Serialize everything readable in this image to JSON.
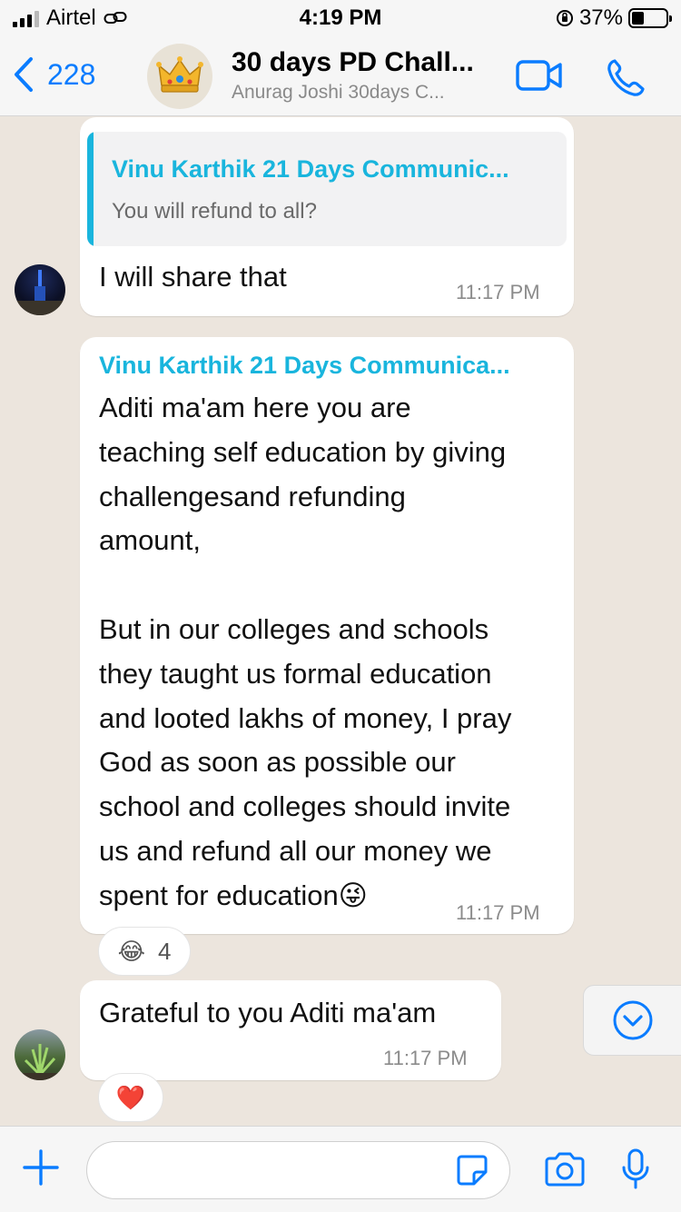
{
  "status_bar": {
    "carrier": "Airtel",
    "time": "4:19 PM",
    "battery": "37%",
    "battery_level": 0.37
  },
  "header": {
    "back_count": "228",
    "title": "30 days PD Chall...",
    "subtitle": "Anurag Joshi 30days C...",
    "avatar_icon": "crown-icon"
  },
  "messages": [
    {
      "quote_author": "Vinu Karthik 21 Days Communic...",
      "quote_text": "You will refund to all?",
      "text": "I will share that",
      "time": "11:17 PM"
    },
    {
      "sender": "Vinu Karthik 21 Days Communica...",
      "text": "Aditi ma'am here you are\nteaching self education by giving\nchallengesand refunding\namount,\n\nBut in our colleges and schools\nthey taught us formal education\nand looted lakhs of money, I pray\nGod as soon as possible our\nschool and colleges should invite\nus and refund all our money we\nspent for education😜",
      "time": "11:17 PM",
      "reaction_emoji": "😂",
      "reaction_count": "4"
    },
    {
      "text": "Grateful to you Aditi ma'am",
      "time": "11:17 PM",
      "reaction_emoji": "❤️"
    }
  ],
  "input_bar": {
    "placeholder": ""
  },
  "colors": {
    "accent": "#0a7cff",
    "sender_name": "#19b5dd",
    "chat_bg": "#ece5dd",
    "bubble": "#ffffff"
  }
}
